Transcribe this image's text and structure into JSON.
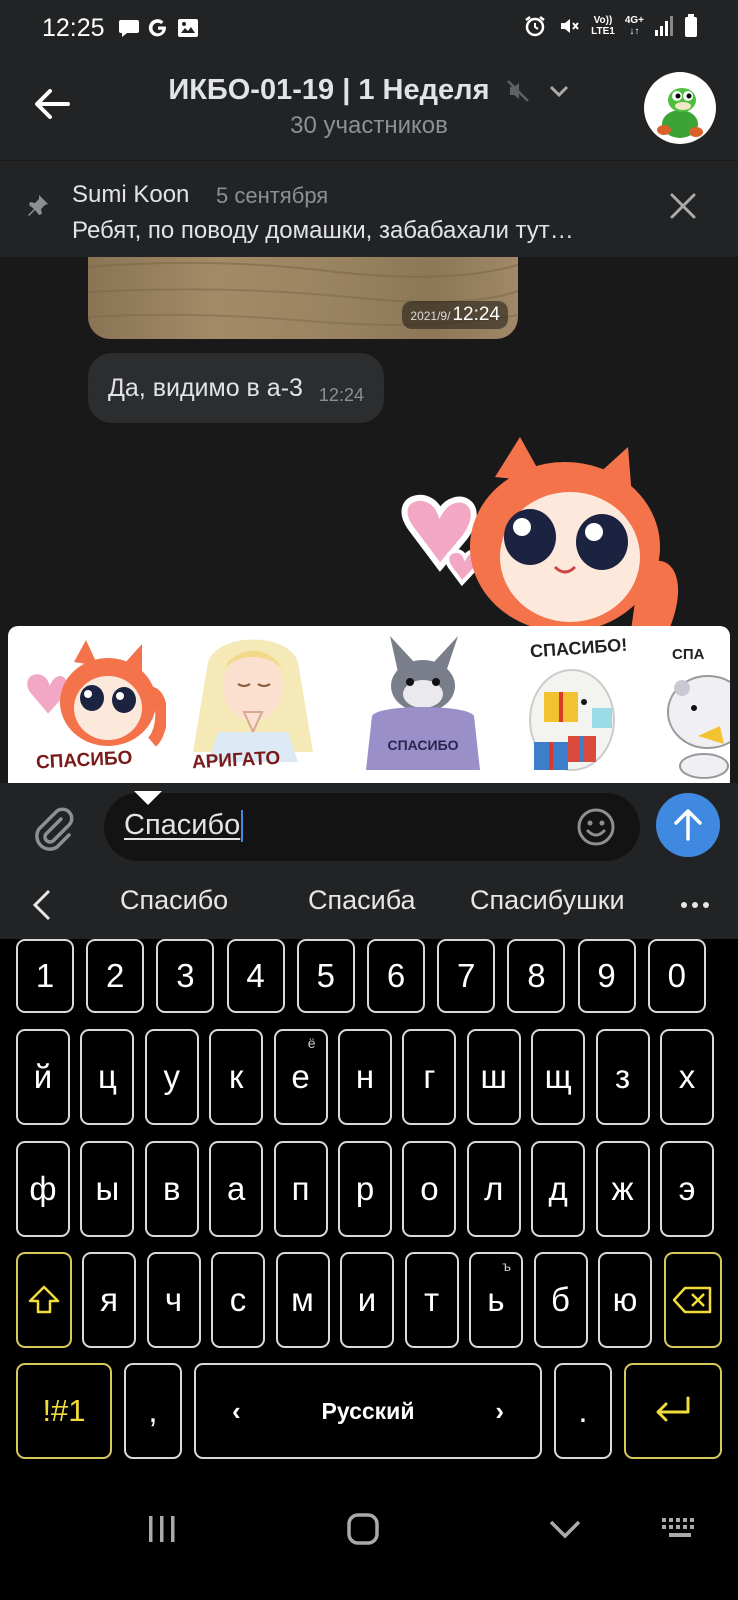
{
  "status_bar": {
    "time": "12:25",
    "network_lte": "LTE1",
    "network_gen": "4G+",
    "volte": "Vo))"
  },
  "header": {
    "title": "ИКБО-01-19 | 1 Неделя",
    "subtitle": "30 участников"
  },
  "pinned": {
    "author": "Sumi Koon",
    "date": "5 сентября",
    "text": "Ребят, по поводу домашки, забабахали тут…"
  },
  "messages": [
    {
      "type": "photo",
      "exif": "2021/9/",
      "time": "12:24"
    },
    {
      "type": "text",
      "text": "Да, видимо в а-3",
      "time": "12:24"
    }
  ],
  "sticker_suggestions": [
    {
      "name": "cat-sticker",
      "caption": "СПАСИБО"
    },
    {
      "name": "elf-sticker",
      "caption": "АРИГАТО"
    },
    {
      "name": "bunny-sweater-sticker",
      "caption": "СПАСИБО"
    },
    {
      "name": "seal-gifts-sticker",
      "caption": "СПАСИБО!"
    },
    {
      "name": "hamster-sticker",
      "caption": "СПА"
    }
  ],
  "composer": {
    "text": "Спасибо"
  },
  "suggestions": [
    "Спасибо",
    "Спасиба",
    "Спасибушки"
  ],
  "keyboard": {
    "numbers": [
      "1",
      "2",
      "3",
      "4",
      "5",
      "6",
      "7",
      "8",
      "9",
      "0"
    ],
    "row1": [
      "й",
      "ц",
      "у",
      "к",
      "е",
      "н",
      "г",
      "ш",
      "щ",
      "з",
      "х"
    ],
    "row1_sup": {
      "е": "ё"
    },
    "row2": [
      "ф",
      "ы",
      "в",
      "а",
      "п",
      "р",
      "о",
      "л",
      "д",
      "ж",
      "э"
    ],
    "row3": [
      "я",
      "ч",
      "с",
      "м",
      "и",
      "т",
      "ь",
      "б",
      "ю"
    ],
    "row3_sup": {
      "ь": "ъ"
    },
    "symbols_label": "!#1",
    "comma": ",",
    "space_label": "Русский",
    "period": "."
  },
  "colors": {
    "background": "#19191a",
    "panel": "#222324",
    "accent": "#3f8ae0",
    "keyboard_accent": "#f2dc3c"
  }
}
